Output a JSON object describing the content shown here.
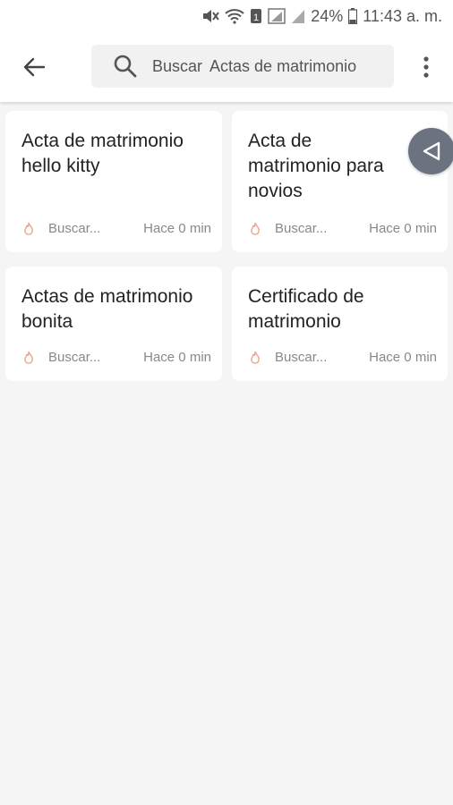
{
  "status_bar": {
    "battery": "24%",
    "time": "11:43 a. m.",
    "icons": [
      "mute-icon",
      "wifi-icon",
      "sim-icon",
      "signal-icon",
      "signal-icon",
      "battery-icon"
    ]
  },
  "app_bar": {
    "back_icon": "arrow-left-icon",
    "search": {
      "prefix": "Buscar",
      "query": "Actas de matrimonio"
    },
    "menu_icon": "more-vert-icon"
  },
  "results": [
    {
      "title": "Acta de matrimonio hello kitty",
      "source": "Buscar...",
      "time": "Hace 0 min"
    },
    {
      "title": "Acta de matrimonio para novios",
      "source": "Buscar...",
      "time": "Hace 0 min"
    },
    {
      "title": "Actas de matrimonio bonita",
      "source": "Buscar...",
      "time": "Hace 0 min"
    },
    {
      "title": "Certificado de matrimonio",
      "source": "Buscar...",
      "time": "Hace 0 min"
    }
  ],
  "floating_button": {
    "icon": "play-triangle-icon"
  },
  "colors": {
    "flame": "#f0a08a",
    "fab": "#6b7280",
    "background": "#f5f5f5"
  }
}
